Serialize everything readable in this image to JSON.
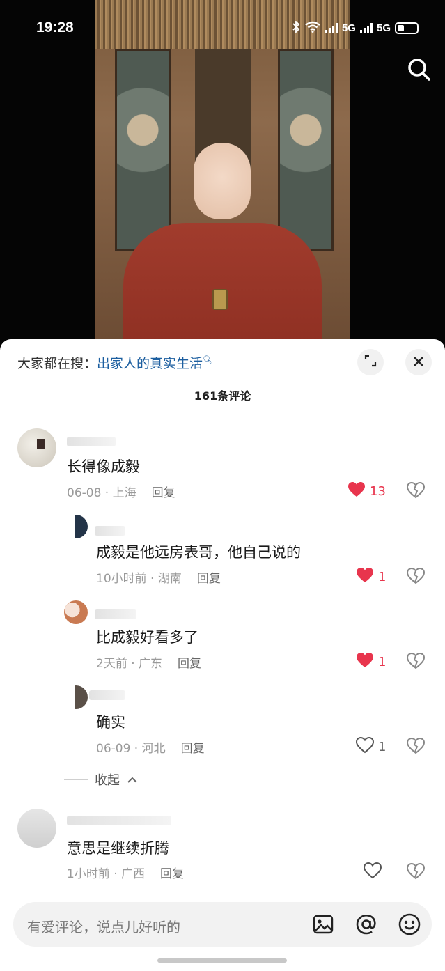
{
  "status": {
    "time": "19:28",
    "network1": "5G",
    "network2": "5G"
  },
  "sheet": {
    "search_prefix": "大家都在搜：",
    "search_term": "出家人的真实生活",
    "comment_count": "161条评论"
  },
  "comments": [
    {
      "text": "长得像成毅",
      "time": "06-08",
      "location": "上海",
      "reply": "回复",
      "likes": "13",
      "liked": true
    },
    {
      "text": "成毅是他远房表哥，他自己说的",
      "time": "10小时前",
      "location": "湖南",
      "reply": "回复",
      "likes": "1",
      "liked": true
    },
    {
      "text": "比成毅好看多了",
      "time": "2天前",
      "location": "广东",
      "reply": "回复",
      "likes": "1",
      "liked": true
    },
    {
      "text": "确实",
      "time": "06-09",
      "location": "河北",
      "reply": "回复",
      "likes": "1",
      "liked": false
    },
    {
      "text": "意思是继续折腾",
      "time": "1小时前",
      "location": "广西",
      "reply": "回复",
      "likes": "",
      "liked": false
    }
  ],
  "collapse_label": "收起",
  "input": {
    "placeholder": "有爱评论，说点儿好听的"
  },
  "colors": {
    "like_red": "#e8354d",
    "link_blue": "#1d5fa0"
  },
  "icons": [
    "search-icon",
    "expand-icon",
    "close-icon",
    "heart-icon",
    "broken-heart-icon",
    "image-icon",
    "at-icon",
    "emoji-icon"
  ]
}
